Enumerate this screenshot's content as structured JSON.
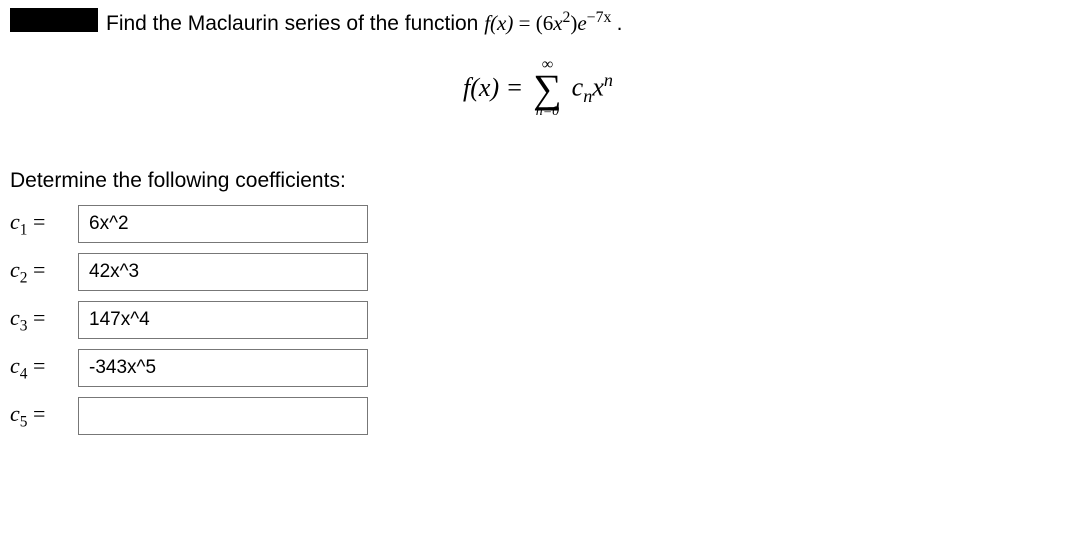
{
  "question": {
    "intro": "Find the Maclaurin series of the function ",
    "func_lhs": "f(x)",
    "equals": " = ",
    "func_rhs_coef": "(6",
    "func_rhs_var": "x",
    "func_rhs_exp1": "2",
    "func_rhs_mid": ")",
    "func_rhs_e": "e",
    "func_rhs_exp2": "−7x",
    "period": "."
  },
  "series": {
    "lhs": "f(x) = ",
    "sigma_top": "∞",
    "sigma_bottom": "n=0",
    "term_c": "c",
    "term_c_sub": "n",
    "term_x": "x",
    "term_x_sup": "n"
  },
  "prompt": "Determine the following coefficients:",
  "coefficients": [
    {
      "label_c": "c",
      "label_sub": "1",
      "label_eq": " =",
      "value": "6x^2"
    },
    {
      "label_c": "c",
      "label_sub": "2",
      "label_eq": " =",
      "value": "42x^3"
    },
    {
      "label_c": "c",
      "label_sub": "3",
      "label_eq": " =",
      "value": "147x^4"
    },
    {
      "label_c": "c",
      "label_sub": "4",
      "label_eq": " =",
      "value": "-343x^5"
    },
    {
      "label_c": "c",
      "label_sub": "5",
      "label_eq": " =",
      "value": ""
    }
  ]
}
